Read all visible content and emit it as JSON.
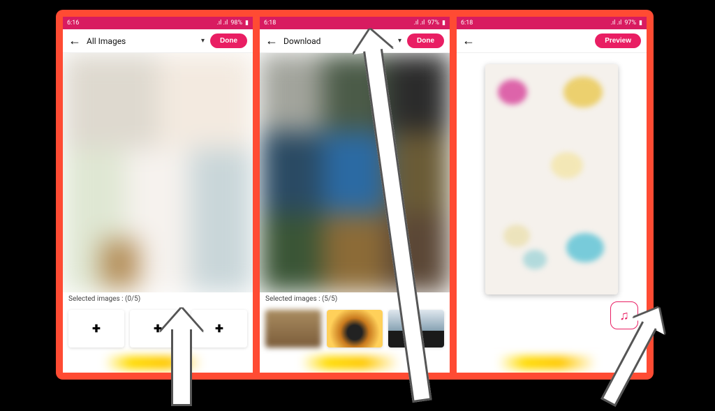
{
  "screens": [
    {
      "statusbar": {
        "time": "6:16",
        "battery": "98%"
      },
      "dropdown_label": "All Images",
      "action_label": "Done",
      "selected_text": "Selected images : (0/5)"
    },
    {
      "statusbar": {
        "time": "6:18",
        "battery": "97%"
      },
      "dropdown_label": "Download",
      "action_label": "Done",
      "selected_text": "Selected images : (5/5)"
    },
    {
      "statusbar": {
        "time": "6:18",
        "battery": "97%"
      },
      "action_label": "Preview"
    }
  ],
  "icons": {
    "back": "←",
    "chevron": "▾",
    "plus": "+",
    "music": "♫",
    "signal": "📶",
    "batt": "▮"
  }
}
